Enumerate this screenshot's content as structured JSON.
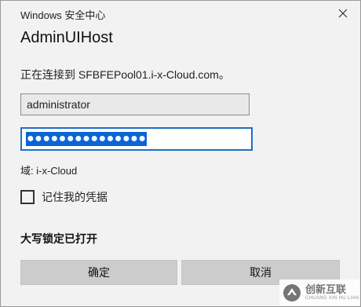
{
  "window": {
    "title": "Windows 安全中心",
    "close_icon": "close-icon"
  },
  "dialog": {
    "app_title": "AdminUIHost",
    "connecting_text": "正在连接到 SFBFEPool01.i-x-Cloud.com。",
    "username_value": "administrator",
    "password_mask": "●●●●●●●●●●●●●●●",
    "domain_text": "域: i-x-Cloud",
    "remember_label": "记住我的凭据",
    "remember_checked": false,
    "capslock_warning": "大写锁定已打开",
    "ok_label": "确定",
    "cancel_label": "取消"
  },
  "watermark": {
    "text": "创新互联",
    "subtext": "CHUANG XIN HU LIAN",
    "logo_icon": "brand-logo-icon"
  },
  "colors": {
    "dialog_bg": "#f2f2f2",
    "focus_border": "#1f6fc5",
    "selection": "#0a64d8",
    "button_bg": "#cccccc"
  }
}
